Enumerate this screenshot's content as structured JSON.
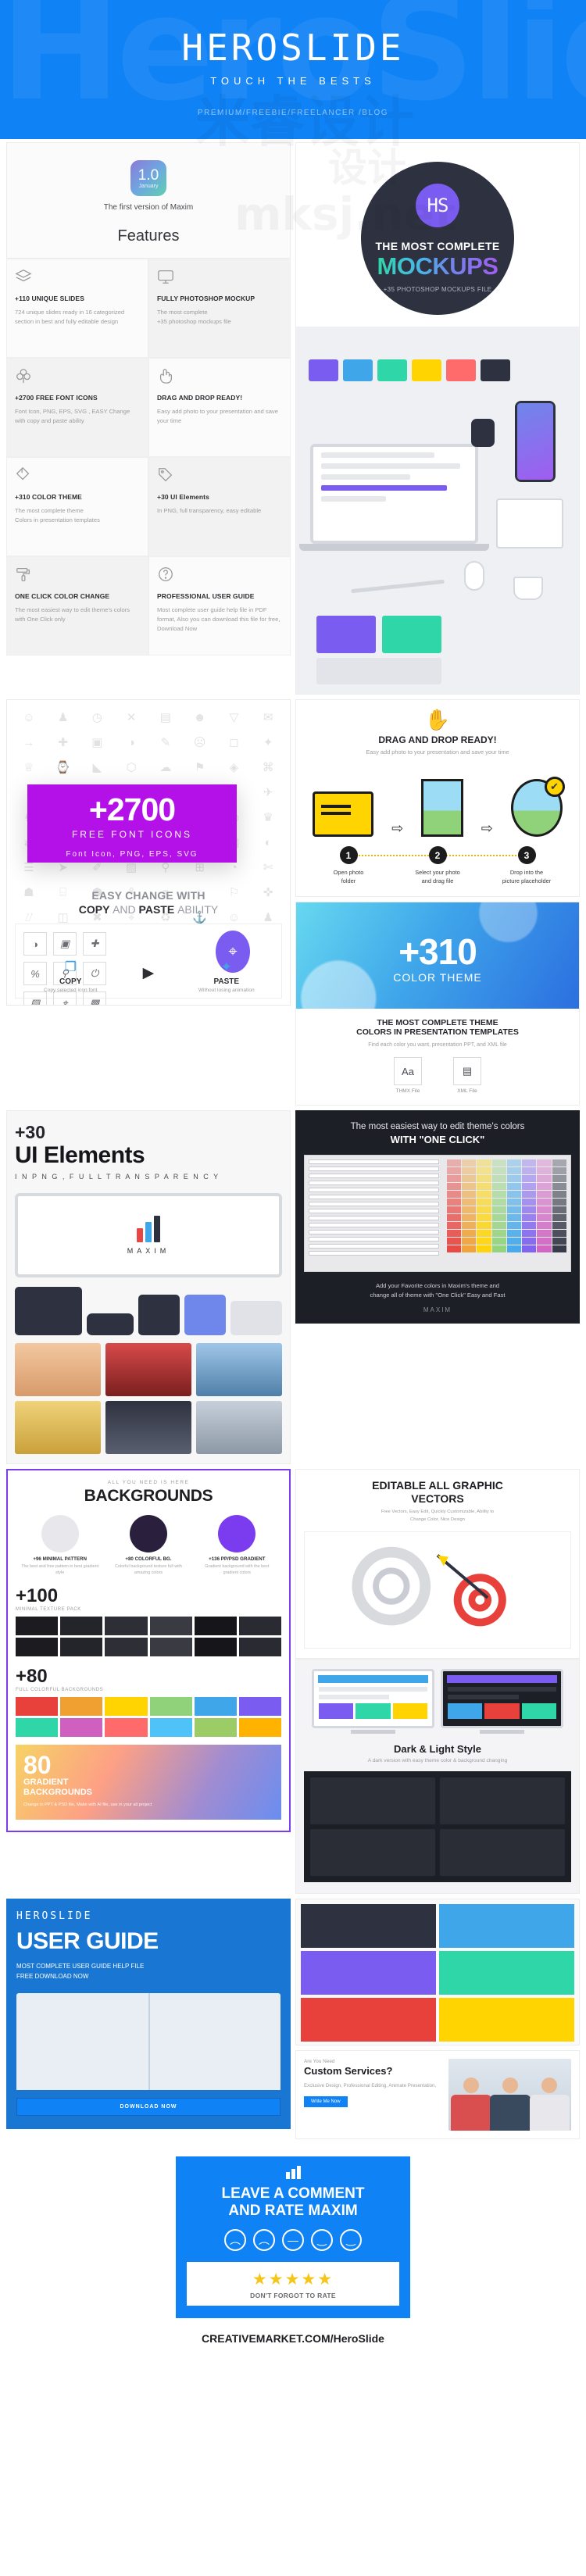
{
  "hero": {
    "ghost_text": "HeroSlide",
    "logo": "HEROSLIDE",
    "tagline": "TOUCH THE BESTS",
    "links": "PREMIUM/FREEBIE/FREELANCER /BLOG",
    "bg_color": "#0f82f5"
  },
  "version": {
    "number": "1.0",
    "month": "January",
    "subtitle": "The first version of Maxim",
    "features_title": "Features"
  },
  "features": [
    {
      "icon": "layers-icon",
      "title": "+110 UNIQUE SLIDES",
      "desc": "724 unique slides ready in 16 categorized section in best and fully editable design"
    },
    {
      "icon": "monitor-icon",
      "title": "FULLY PHOTOSHOP MOCKUP",
      "desc": "The most complete\n+35 photoshop mockups file"
    },
    {
      "icon": "clover-icon",
      "title": "+2700 FREE FONT ICONS",
      "desc": "Font Icon, PNG, EPS, SVG , EASY Change with copy and paste ability"
    },
    {
      "icon": "hand-pointer-icon",
      "title": "DRAG AND DROP READY!",
      "desc": "Easy add photo to your presentation and save your time"
    },
    {
      "icon": "color-fill-icon",
      "title": "+310 COLOR THEME",
      "desc": "The most complete theme\nColors in presentation templates"
    },
    {
      "icon": "tag-icon",
      "title": "+30 UI Elements",
      "desc": "In PNG, full transparency, easy editable"
    },
    {
      "icon": "paint-roller-icon",
      "title": "ONE CLICK COLOR CHANGE",
      "desc": "The most easiest way to edit theme's colors with One Click only"
    },
    {
      "icon": "question-circle-icon",
      "title": "PROFESSIONAL USER GUIDE",
      "desc": "Most complete user guide help file in PDF format, Also you can download this file for free, Download Now"
    }
  ],
  "mockups": {
    "monogram": "HS",
    "line1": "THE MOST COMPLETE",
    "line2": "MOCKUPS",
    "line3": "+35 PHOTOSHOP MOCKUPS FILE",
    "circle_color": "#2e3240",
    "badge_color": "#7b5cf0"
  },
  "font_icons": {
    "count": "+2700",
    "label": "FREE FONT ICONS",
    "formats": "Font Icon, PNG, EPS, SVG",
    "box_color": "#b311e8",
    "easy_line1": "EASY CHANGE WITH",
    "easy_copy": "COPY",
    "easy_and": "AND",
    "easy_paste": "PASTE",
    "easy_ability": "ABILITY",
    "copy_title": "COPY",
    "copy_sub": "Copy selected icon font",
    "paste_title": "PASTE",
    "paste_sub": "Without losing animation"
  },
  "drag_drop": {
    "title": "DRAG AND DROP READY!",
    "subtitle": "Easy add photo to your presentation and save your time",
    "steps": [
      {
        "num": "1",
        "label": "Open photo\nfolder"
      },
      {
        "num": "2",
        "label": "Select your photo\nand drag file"
      },
      {
        "num": "3",
        "label": "Drop into the\npicture placeholder"
      }
    ]
  },
  "color_theme": {
    "count": "+310",
    "label": "COLOR THEME",
    "cap1": "THE MOST COMPLETE THEME",
    "cap2": "COLORS IN PRESENTATION TEMPLATES",
    "cap3": "Find each color you want, presentation PPT, and XML file",
    "files": [
      {
        "icon": "Aa",
        "name": "THMX File"
      },
      {
        "icon": "▤",
        "name": "XML File"
      }
    ]
  },
  "ui_elements": {
    "count": "+30",
    "title": "UI Elements",
    "subtitle": "I N   P N G ,   F U L L   T R A N S P A R E N C Y",
    "brand": "MAXIM"
  },
  "one_click": {
    "line1": "The most easiest way to edit theme's colors",
    "line2": "WITH \"ONE CLICK\"",
    "footer": "Add your Favorite colors in Maxim's theme and\nchange all of theme with \"One Click\" Easy and Fast",
    "brand": "MAXIM"
  },
  "backgrounds": {
    "eyebrow": "ALL YOU NEED IS HERE",
    "title": "BACKGROUNDS",
    "types": [
      {
        "name": "+96 MINIMAL PATTERN",
        "desc": "The best and free pattern in best gradient style",
        "color": "#e8e8ec"
      },
      {
        "name": "+80 COLORFUL BG.",
        "desc": "Colorful background texture full with amazing colors",
        "color": "#2a1f3d"
      },
      {
        "name": "+136 PP/PSD GRADIENT",
        "desc": "Gradient background with the best gradient colors",
        "color": "#7b3cf0"
      }
    ],
    "count_100": "+100",
    "count_100_sub": "MINIMAL TEXTURE PACK",
    "count_80": "+80",
    "count_80_sub": "FULL COLORFUL BACKGROUNDS",
    "gradient_num": "80",
    "gradient_title": "GRADIENT\nBACKGROUNDS",
    "gradient_sub": "Change in PPT & PSD file, Make with AI file, use in your all project"
  },
  "vectors": {
    "title": "EDITABLE ALL GRAPHIC\nVECTORS",
    "subtitle": "Free Vectors, Easy Edit, Quickly Customizable, Ability to\nChange Color, Nice Design"
  },
  "dark_light": {
    "title": "Dark & Light Style",
    "subtitle": "A dark version with easy theme color & background changing"
  },
  "user_guide": {
    "brand": "HEROSLIDE",
    "title": "USER GUIDE",
    "subtitle": "MOST COMPLETE USER GUIDE HELP FILE\nFREE DOWNLOAD NOW",
    "button": "DOWNLOAD NOW"
  },
  "custom_services": {
    "eyebrow": "Are You Need",
    "title": "Custom Services?",
    "desc": "Exclusive Design, Professional Editing, Animate Presentation,",
    "button": "Write Me Now"
  },
  "rate": {
    "title": "LEAVE A COMMENT\nAND RATE MAXIM",
    "faces": [
      "angry-face",
      "sad-face",
      "neutral-face",
      "happy-face",
      "very-happy-face"
    ],
    "stars": "★★★★★",
    "stars_label": "DON'T FORGOT TO RATE",
    "bg_color": "#0f82f5"
  },
  "footer": {
    "prefix": "CREATIVEMARKET.COM/",
    "brand": "HeroSlide"
  },
  "watermarks": [
    "米睿设计",
    "mksj.net"
  ]
}
